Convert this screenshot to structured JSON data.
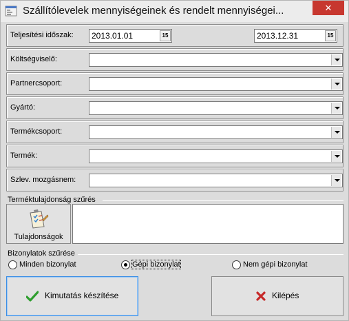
{
  "window": {
    "title": "Szállítólevelek mennyiségeinek és rendelt mennyiségei...",
    "close_glyph": "✕"
  },
  "period": {
    "label": "Teljesítési időszak:",
    "date_from": "2013.01.01",
    "date_to": "2013.12.31",
    "calendar_glyph": "15"
  },
  "filters": [
    {
      "label": "Költségviselő:",
      "value": ""
    },
    {
      "label": "Partnercsoport:",
      "value": ""
    },
    {
      "label": "Gyártó:",
      "value": ""
    },
    {
      "label": "Termékcsoport:",
      "value": ""
    },
    {
      "label": "Termék:",
      "value": ""
    },
    {
      "label": "Szlev. mozgásnem:",
      "value": ""
    }
  ],
  "property_filter": {
    "title": "Terméktulajdonság szűrés",
    "button_label": "Tulajdonságok",
    "button_icon": "clipboard-checklist-icon"
  },
  "doc_filter": {
    "title": "Bizonylatok szűrése",
    "options": [
      {
        "label": "Minden bizonylat",
        "selected": false
      },
      {
        "label": "Gépi bizonylat",
        "selected": true
      },
      {
        "label": "Nem gépi bizonylat",
        "selected": false
      }
    ]
  },
  "actions": {
    "run_label": "Kimutatás készítése",
    "run_icon": "checkmark-icon",
    "exit_label": "Kilépés",
    "exit_icon": "red-x-icon"
  },
  "colors": {
    "close_button": "#c7372f",
    "check_green": "#2e9e2e",
    "exit_red": "#c62828",
    "focus_border": "#3a8ee6"
  }
}
